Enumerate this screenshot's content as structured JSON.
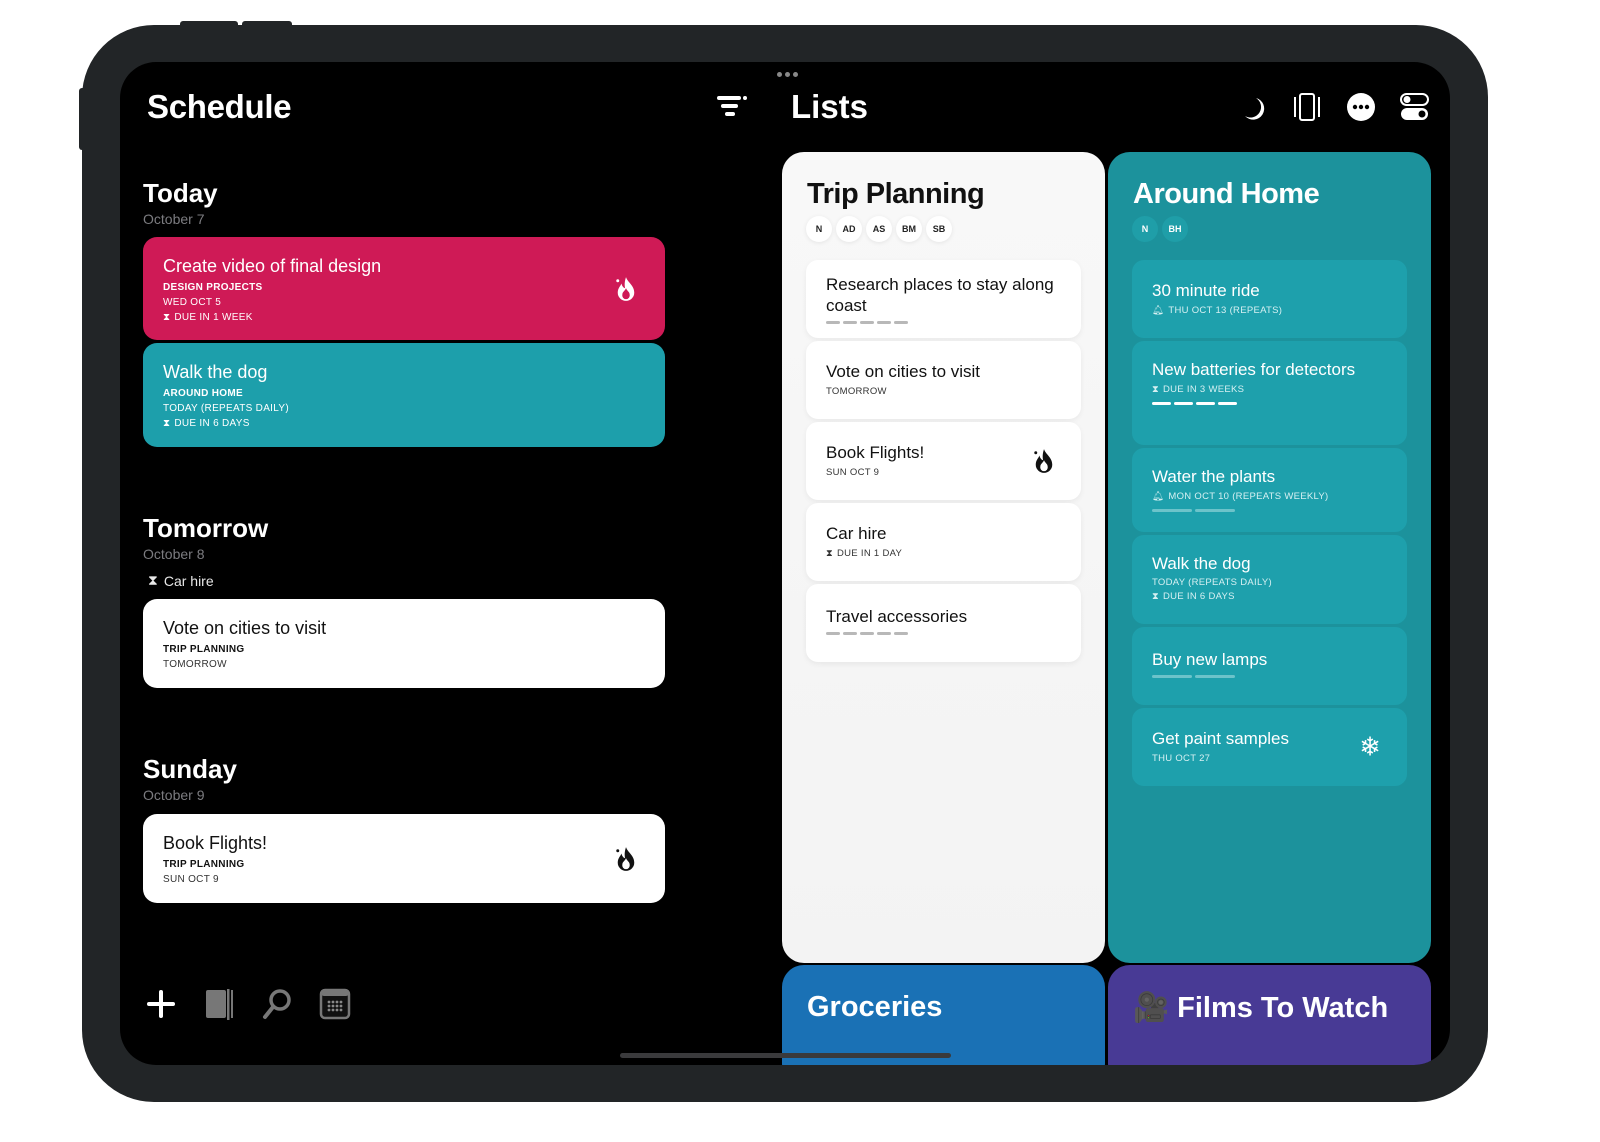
{
  "schedule": {
    "title": "Schedule",
    "days": [
      {
        "heading": "Today",
        "date": "October 7",
        "cards": [
          {
            "title": "Create video of final design",
            "list": "DESIGN PROJECTS",
            "date": "WED OCT 5",
            "due": "DUE IN 1 WEEK",
            "color": "#cf1a56",
            "priority_icon": "flame-icon"
          },
          {
            "title": "Walk the dog",
            "list": "AROUND HOME",
            "date": "TODAY (REPEATS DAILY)",
            "due": "DUE IN 6 DAYS",
            "color": "#1d9fab"
          }
        ]
      },
      {
        "heading": "Tomorrow",
        "date": "October 8",
        "due_reminder": "Car hire",
        "cards": [
          {
            "title": "Vote on cities to visit",
            "list": "TRIP PLANNING",
            "date": "TOMORROW",
            "color": "#ffffff"
          }
        ]
      },
      {
        "heading": "Sunday",
        "date": "October 9",
        "cards": [
          {
            "title": "Book Flights!",
            "list": "TRIP PLANNING",
            "date": "SUN OCT 9",
            "color": "#ffffff",
            "priority_icon": "flame-icon"
          }
        ]
      }
    ],
    "toolbar": [
      "add-icon",
      "notebook-icon",
      "search-icon",
      "calendar-icon"
    ]
  },
  "lists": {
    "title": "Lists",
    "header_icons": [
      "moon-icon",
      "device-frame-icon",
      "more-icon",
      "toggles-icon"
    ],
    "columns": [
      {
        "title": "Trip Planning",
        "color": "#f6f6f6",
        "members": [
          "N",
          "AD",
          "AS",
          "BM",
          "SB"
        ],
        "items": [
          {
            "title": "Research places to stay along coast",
            "subtasks": 5
          },
          {
            "title": "Vote on cities to visit",
            "meta": "TOMORROW"
          },
          {
            "title": "Book Flights!",
            "meta": "SUN OCT 9",
            "icon": "flame-icon"
          },
          {
            "title": "Car hire",
            "meta": "DUE IN 1 DAY",
            "meta_icon": "hourglass-icon"
          },
          {
            "title": "Travel accessories",
            "subtasks": 5
          }
        ]
      },
      {
        "title": "Around Home",
        "color": "#1c929c",
        "members": [
          "N",
          "BH"
        ],
        "items": [
          {
            "title": "30 minute ride",
            "meta": "THU OCT 13 (REPEATS)",
            "meta_icon": "bell-icon"
          },
          {
            "title": "New batteries for detectors",
            "meta": "DUE IN 3 WEEKS",
            "meta_icon": "hourglass-icon",
            "subtasks": 4,
            "subtasks_done": 4
          },
          {
            "title": "Water the plants",
            "meta": "MON OCT 10 (REPEATS WEEKLY)",
            "meta_icon": "bell-icon",
            "subtasks": 2,
            "subtasks_done": 0
          },
          {
            "title": "Walk the dog",
            "meta": "TODAY (REPEATS DAILY)",
            "meta2": "DUE IN 6 DAYS",
            "meta2_icon": "hourglass-icon"
          },
          {
            "title": "Buy new lamps",
            "subtasks": 2,
            "subtasks_done": 0
          },
          {
            "title": "Get paint samples",
            "meta": "THU OCT 27",
            "icon": "snowflake-icon"
          }
        ]
      },
      {
        "title": "Groceries",
        "color": "#1a71b5"
      },
      {
        "title": "Films To Watch",
        "color": "#483a95",
        "emoji": "🎥"
      }
    ]
  }
}
